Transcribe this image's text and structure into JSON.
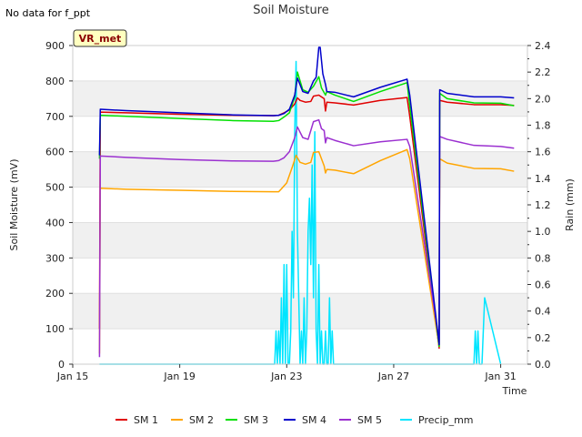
{
  "header": {
    "title": "Soil Moisture",
    "no_data_note": "No data for f_ppt",
    "badge": "VR_met"
  },
  "chart_data": {
    "type": "line",
    "title": "Soil Moisture",
    "xlabel": "Time",
    "ylabel": "Soil Moisture (mV)",
    "y2label": "Rain (mm)",
    "xlim": [
      0,
      17
    ],
    "ylim": [
      0,
      900
    ],
    "y2lim": [
      0,
      2.4
    ],
    "x_ticks": [
      0,
      4,
      8,
      12,
      16
    ],
    "x_tick_labels": [
      "Jan 15",
      "Jan 19",
      "Jan 23",
      "Jan 27",
      "Jan 31"
    ],
    "y_ticks": [
      0,
      100,
      200,
      300,
      400,
      500,
      600,
      700,
      800,
      900
    ],
    "y2_ticks": [
      0.0,
      0.2,
      0.4,
      0.6,
      0.8,
      1.0,
      1.2,
      1.4,
      1.6,
      1.8,
      2.0,
      2.2,
      2.4
    ],
    "y2_tick_labels": [
      "0.0",
      "0.2",
      "0.4",
      "0.6",
      "0.8",
      "1.0",
      "1.2",
      "1.4",
      "1.6",
      "1.8",
      "2.0",
      "2.2",
      "2.4"
    ],
    "grid": "horizontal bands",
    "legend_position": "bottom",
    "series": [
      {
        "name": "SM 1",
        "color": "#e00000",
        "axis": "left",
        "x": [
          1.0,
          1.03,
          2,
          4,
          6,
          7.5,
          7.7,
          7.9,
          8.1,
          8.3,
          8.4,
          8.5,
          8.7,
          8.9,
          9.0,
          9.2,
          9.4,
          9.45,
          9.5,
          9.8,
          10.5,
          11.5,
          12.5,
          12.6,
          13.7,
          13.72,
          14,
          15,
          16,
          16.5
        ],
        "y": [
          100,
          712,
          710,
          706,
          703,
          702,
          703,
          710,
          718,
          735,
          752,
          745,
          740,
          742,
          757,
          760,
          750,
          715,
          740,
          738,
          732,
          745,
          753,
          700,
          45,
          745,
          740,
          733,
          733,
          731
        ]
      },
      {
        "name": "SM 2",
        "color": "#ffa500",
        "axis": "left",
        "x": [
          1.0,
          1.03,
          2,
          4,
          6,
          7.5,
          7.7,
          7.8,
          8.0,
          8.2,
          8.35,
          8.5,
          8.7,
          8.9,
          9.0,
          9.2,
          9.4,
          9.45,
          9.5,
          9.8,
          10.5,
          11.5,
          12.5,
          12.6,
          13.7,
          13.72,
          14,
          15,
          16,
          16.5
        ],
        "y": [
          30,
          497,
          494,
          491,
          488,
          487,
          487,
          495,
          512,
          555,
          590,
          570,
          565,
          570,
          598,
          600,
          560,
          540,
          550,
          548,
          538,
          575,
          606,
          580,
          50,
          580,
          568,
          553,
          552,
          545
        ]
      },
      {
        "name": "SM 3",
        "color": "#00e000",
        "axis": "left",
        "x": [
          1.0,
          1.03,
          2,
          4,
          6,
          7.5,
          7.7,
          7.9,
          8.1,
          8.3,
          8.4,
          8.6,
          8.8,
          9.0,
          9.2,
          9.3,
          9.45,
          9.5,
          9.8,
          10.5,
          11.5,
          12.5,
          12.6,
          13.7,
          13.72,
          14,
          15,
          16,
          16.5
        ],
        "y": [
          580,
          703,
          700,
          694,
          688,
          686,
          688,
          698,
          710,
          755,
          825,
          775,
          768,
          785,
          812,
          780,
          760,
          770,
          760,
          742,
          770,
          795,
          730,
          50,
          765,
          750,
          738,
          737,
          730
        ]
      },
      {
        "name": "SM 4",
        "color": "#0000cc",
        "axis": "left",
        "x": [
          1.0,
          1.03,
          2,
          4,
          6,
          7.5,
          7.7,
          7.9,
          8.1,
          8.3,
          8.4,
          8.6,
          8.8,
          9.0,
          9.1,
          9.2,
          9.25,
          9.35,
          9.45,
          9.5,
          9.8,
          10.5,
          11.5,
          12.5,
          12.6,
          13.7,
          13.72,
          14,
          15,
          16,
          16.5
        ],
        "y": [
          590,
          720,
          716,
          710,
          704,
          702,
          703,
          708,
          720,
          760,
          808,
          770,
          765,
          800,
          810,
          895,
          895,
          820,
          790,
          770,
          768,
          755,
          782,
          805,
          760,
          55,
          775,
          765,
          755,
          755,
          752
        ]
      },
      {
        "name": "SM 5",
        "color": "#9b30d0",
        "axis": "left",
        "x": [
          1.0,
          1.03,
          2,
          4,
          6,
          7.5,
          7.7,
          7.9,
          8.1,
          8.3,
          8.4,
          8.6,
          8.8,
          9.0,
          9.2,
          9.3,
          9.4,
          9.45,
          9.5,
          9.8,
          10.5,
          11.5,
          12.5,
          12.6,
          13.7,
          13.72,
          14,
          15,
          16,
          16.5
        ],
        "y": [
          20,
          588,
          584,
          578,
          574,
          573,
          575,
          583,
          600,
          640,
          670,
          640,
          635,
          685,
          690,
          665,
          660,
          625,
          640,
          632,
          617,
          628,
          635,
          615,
          65,
          643,
          635,
          618,
          615,
          610
        ]
      },
      {
        "name": "Precip_mm",
        "color": "#00e5ff",
        "axis": "right",
        "x": [
          1.0,
          7.55,
          7.6,
          7.65,
          7.7,
          7.75,
          7.8,
          7.85,
          7.9,
          7.95,
          8.0,
          8.05,
          8.1,
          8.15,
          8.2,
          8.25,
          8.3,
          8.35,
          8.4,
          8.45,
          8.5,
          8.55,
          8.6,
          8.65,
          8.7,
          8.75,
          8.8,
          8.85,
          8.9,
          8.95,
          9.0,
          9.05,
          9.1,
          9.15,
          9.2,
          9.25,
          9.3,
          9.35,
          9.4,
          9.45,
          9.5,
          9.55,
          9.6,
          9.65,
          9.7,
          9.75,
          9.8,
          9.85,
          9.9,
          9.95,
          10.0,
          15.0,
          15.05,
          15.1,
          15.15,
          15.2,
          15.3,
          15.4,
          16.0
        ],
        "y": [
          0.0,
          0.0,
          0.25,
          0.0,
          0.25,
          0.0,
          0.5,
          0.0,
          0.75,
          0.0,
          0.75,
          0.0,
          0.0,
          0.25,
          1.0,
          0.5,
          1.75,
          2.28,
          1.0,
          0.5,
          0.0,
          0.25,
          0.0,
          0.5,
          0.0,
          0.25,
          1.0,
          1.25,
          0.75,
          1.5,
          0.5,
          1.75,
          0.25,
          0.0,
          0.75,
          0.0,
          0.25,
          0.0,
          0.0,
          0.25,
          0.0,
          0.0,
          0.5,
          0.0,
          0.25,
          0.0,
          0.0,
          0.0,
          0.0,
          0.0,
          0.0,
          0.0,
          0.25,
          0.0,
          0.25,
          0.0,
          0.0,
          0.5,
          0.0
        ]
      }
    ]
  }
}
